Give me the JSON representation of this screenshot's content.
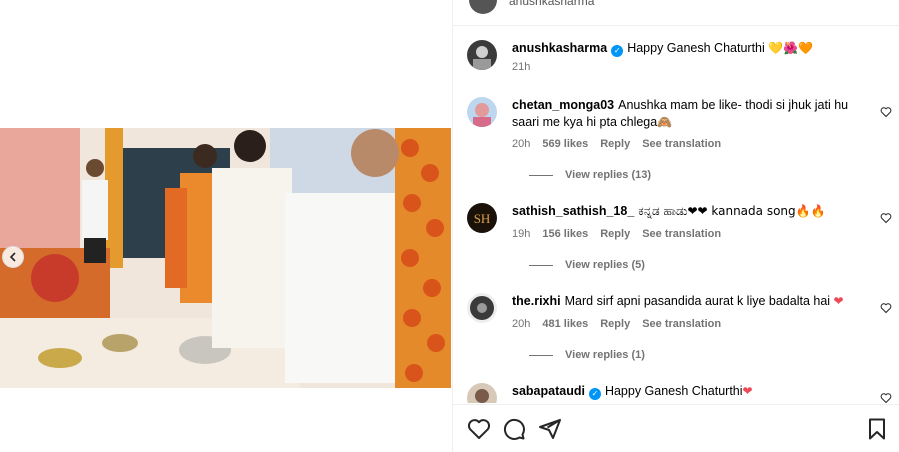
{
  "header": {
    "username": "anushkasharma"
  },
  "caption": {
    "username": "anushkasharma",
    "text": "Happy Ganesh Chaturthi",
    "emojis": "💛🌺🧡",
    "time": "21h"
  },
  "comments": [
    {
      "username": "chetan_monga03",
      "text": "Anushka mam be like- thodi si jhuk jati hu saari me kya hi pta chlega",
      "emoji": "🙈",
      "time": "20h",
      "likes": "569 likes",
      "reply": "Reply",
      "translate": "See translation",
      "view_replies": "View replies (13)"
    },
    {
      "username": "sathish_sathish_18_",
      "text": "ಕನ್ನಡ ಹಾಡು❤❤ kannada song🔥🔥",
      "time": "19h",
      "likes": "156 likes",
      "reply": "Reply",
      "translate": "See translation",
      "view_replies": "View replies (5)"
    },
    {
      "username": "the.rixhi",
      "text": "Mard sirf apni pasandida aurat k liye badalta hai",
      "emoji": "❤",
      "time": "20h",
      "likes": "481 likes",
      "reply": "Reply",
      "translate": "See translation",
      "view_replies": "View replies (1)"
    },
    {
      "username": "sabapataudi",
      "text": "Happy Ganesh Chaturthi",
      "emoji": "❤"
    }
  ],
  "icons": {
    "like": "heart-icon",
    "comment": "comment-icon",
    "share": "send-icon",
    "save": "bookmark-icon",
    "prev": "chevron-left-icon"
  },
  "colors": {
    "verified": "#0095f6",
    "secondary_text": "#737373",
    "heart": "#ed4956"
  }
}
